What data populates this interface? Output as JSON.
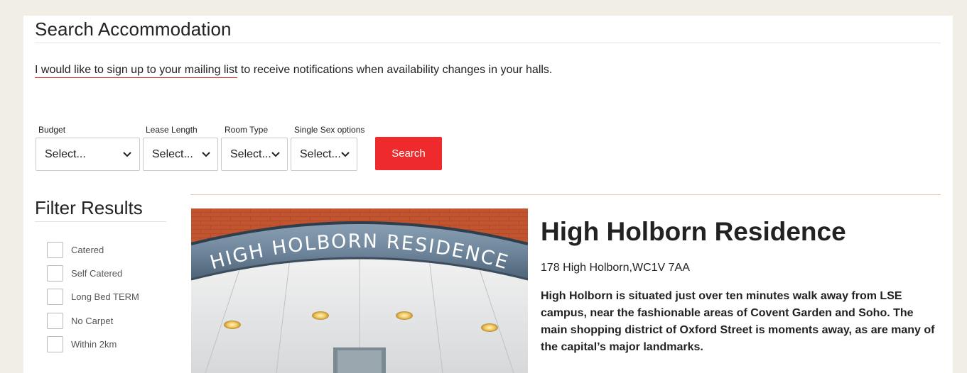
{
  "header": {
    "title": "Search Accommodation"
  },
  "mailing": {
    "link_text": "I would like to sign up to your mailing list",
    "rest_text": " to receive notifications when availability changes in your halls."
  },
  "search_form": {
    "budget": {
      "label": "Budget",
      "value": "Select..."
    },
    "lease_length": {
      "label": "Lease Length",
      "value": "Select..."
    },
    "room_type": {
      "label": "Room Type",
      "value": "Select..."
    },
    "single_sex": {
      "label": "Single Sex options",
      "value": "Select..."
    },
    "search_button": "Search"
  },
  "filters": {
    "title": "Filter Results",
    "items": [
      {
        "label": "Catered",
        "checked": false
      },
      {
        "label": "Self Catered",
        "checked": false
      },
      {
        "label": "Long Bed TERM",
        "checked": false
      },
      {
        "label": "No Carpet",
        "checked": false
      },
      {
        "label": "Within 2km",
        "checked": false
      }
    ]
  },
  "result": {
    "name": "High Holborn Residence",
    "address": "178 High Holborn,WC1V 7AA",
    "description": "High Holborn is situated just over ten minutes walk away from LSE campus, near the fashionable areas of Covent Garden and Soho. The main shopping district of Oxford Street is moments away, as are many of the capital’s major landmarks.",
    "photo_sign_text": "HIGH HOLBORN RESIDENCE"
  },
  "colors": {
    "accent": "#ee2a2d",
    "page_background": "#f1eee6"
  }
}
